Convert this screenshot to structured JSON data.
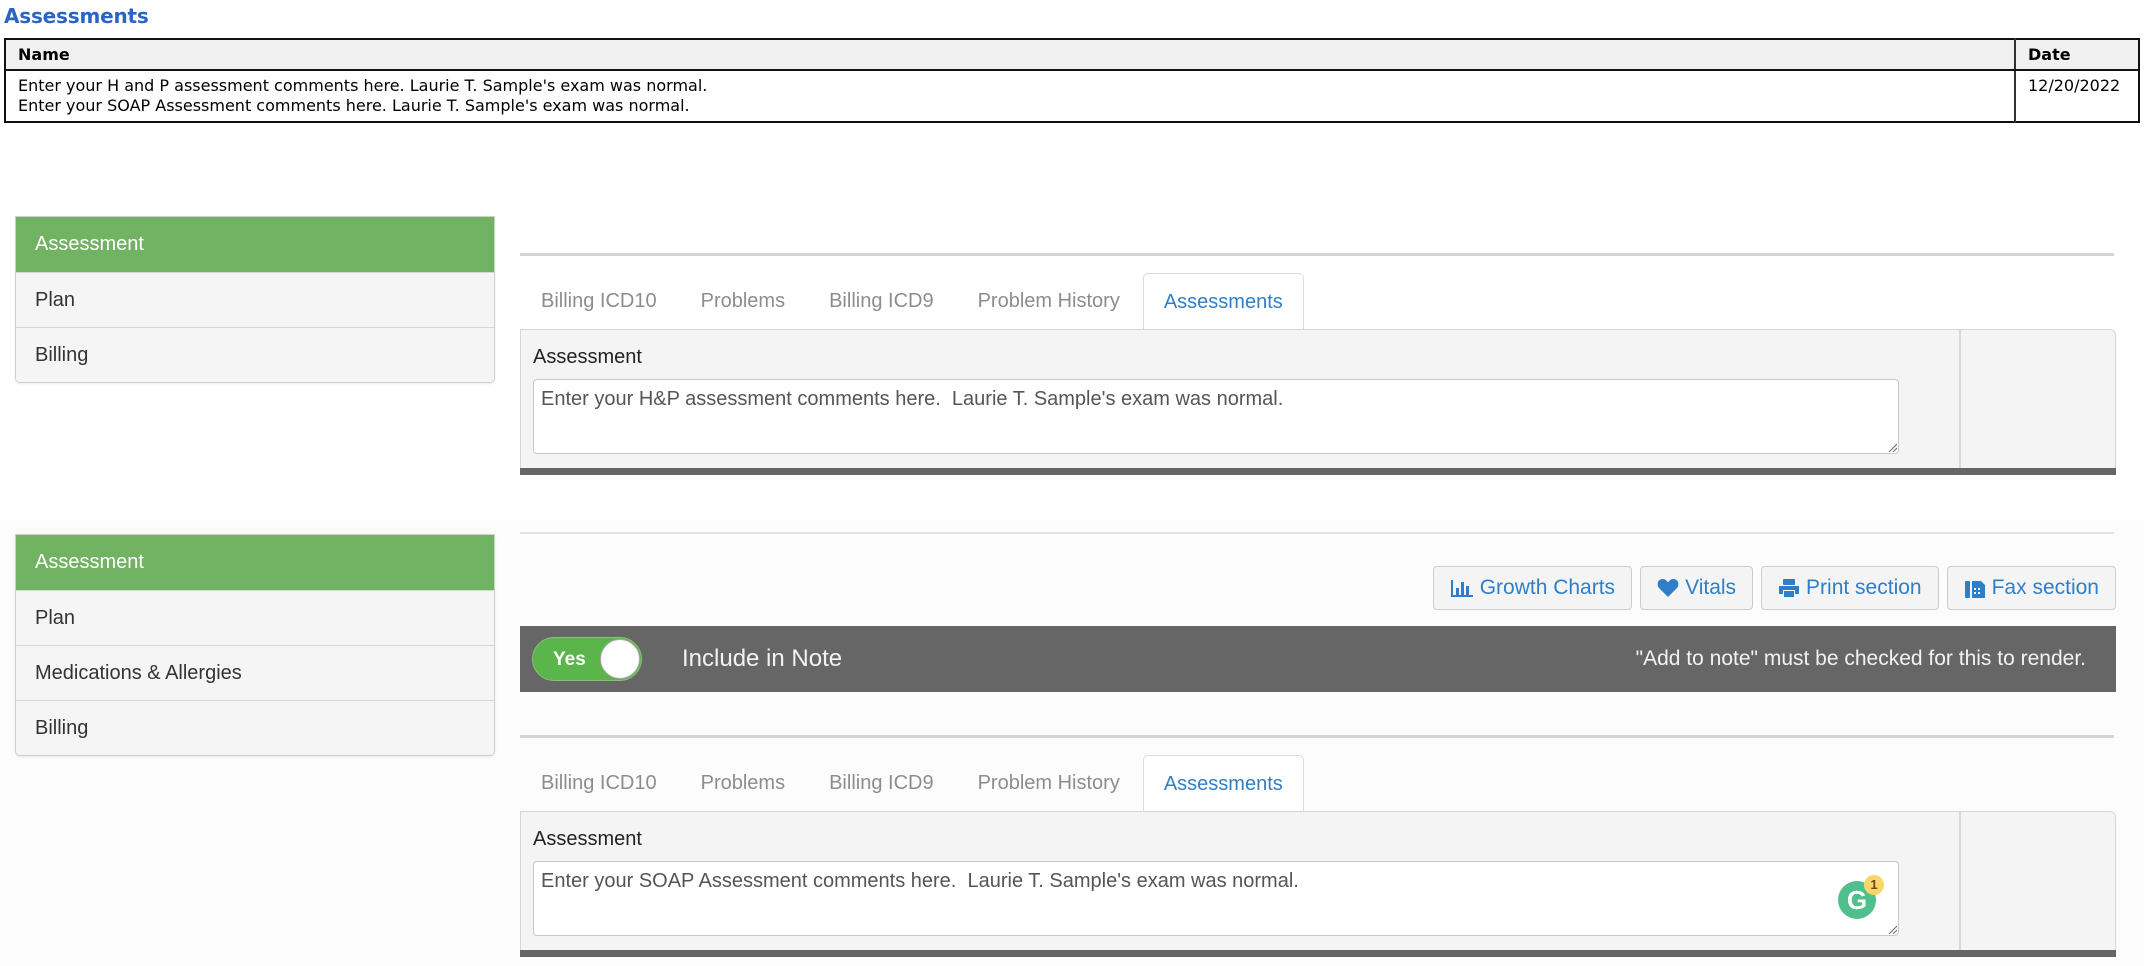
{
  "summary": {
    "title": "Assessments",
    "columns": [
      "Name",
      "Date"
    ],
    "rows": [
      {
        "name_lines": [
          "Enter your H and P assessment comments here. Laurie T. Sample's exam was normal.",
          "Enter your SOAP Assessment comments here. Laurie T. Sample's exam was normal."
        ],
        "date": "12/20/2022"
      }
    ]
  },
  "section1": {
    "nav": [
      {
        "label": "Assessment",
        "active": true
      },
      {
        "label": "Plan",
        "active": false
      },
      {
        "label": "Billing",
        "active": false
      }
    ],
    "tabs": [
      {
        "label": "Billing ICD10",
        "active": false
      },
      {
        "label": "Problems",
        "active": false
      },
      {
        "label": "Billing ICD9",
        "active": false
      },
      {
        "label": "Problem History",
        "active": false
      },
      {
        "label": "Assessments",
        "active": true
      }
    ],
    "panel": {
      "label": "Assessment",
      "value": "Enter your H&P assessment comments here.  Laurie T. Sample's exam was normal."
    }
  },
  "section2": {
    "nav": [
      {
        "label": "Assessment",
        "active": true
      },
      {
        "label": "Plan",
        "active": false
      },
      {
        "label": "Medications & Allergies",
        "active": false
      },
      {
        "label": "Billing",
        "active": false
      }
    ],
    "actions": [
      {
        "label": "Growth Charts",
        "icon": "bar-chart-icon"
      },
      {
        "label": "Vitals",
        "icon": "heart-icon"
      },
      {
        "label": "Print section",
        "icon": "print-icon"
      },
      {
        "label": "Fax section",
        "icon": "fax-icon"
      }
    ],
    "note_bar": {
      "toggle_label": "Yes",
      "toggle_on": true,
      "label": "Include in Note",
      "hint": "\"Add to note\" must be checked for this to render."
    },
    "tabs": [
      {
        "label": "Billing ICD10",
        "active": false
      },
      {
        "label": "Problems",
        "active": false
      },
      {
        "label": "Billing ICD9",
        "active": false
      },
      {
        "label": "Problem History",
        "active": false
      },
      {
        "label": "Assessments",
        "active": true
      }
    ],
    "panel": {
      "label": "Assessment",
      "value": "Enter your SOAP Assessment comments here.  Laurie T. Sample's exam was normal.",
      "grammarly_count": "1"
    }
  },
  "colors": {
    "title_blue": "#2a64c4",
    "nav_active_green": "#71b362",
    "tab_active_blue": "#2f7fc8",
    "note_bar_gray": "#666666",
    "toggle_green": "#5ab54a",
    "grammarly_green": "#4fbf8d",
    "grammarly_badge": "#f9d66b"
  }
}
